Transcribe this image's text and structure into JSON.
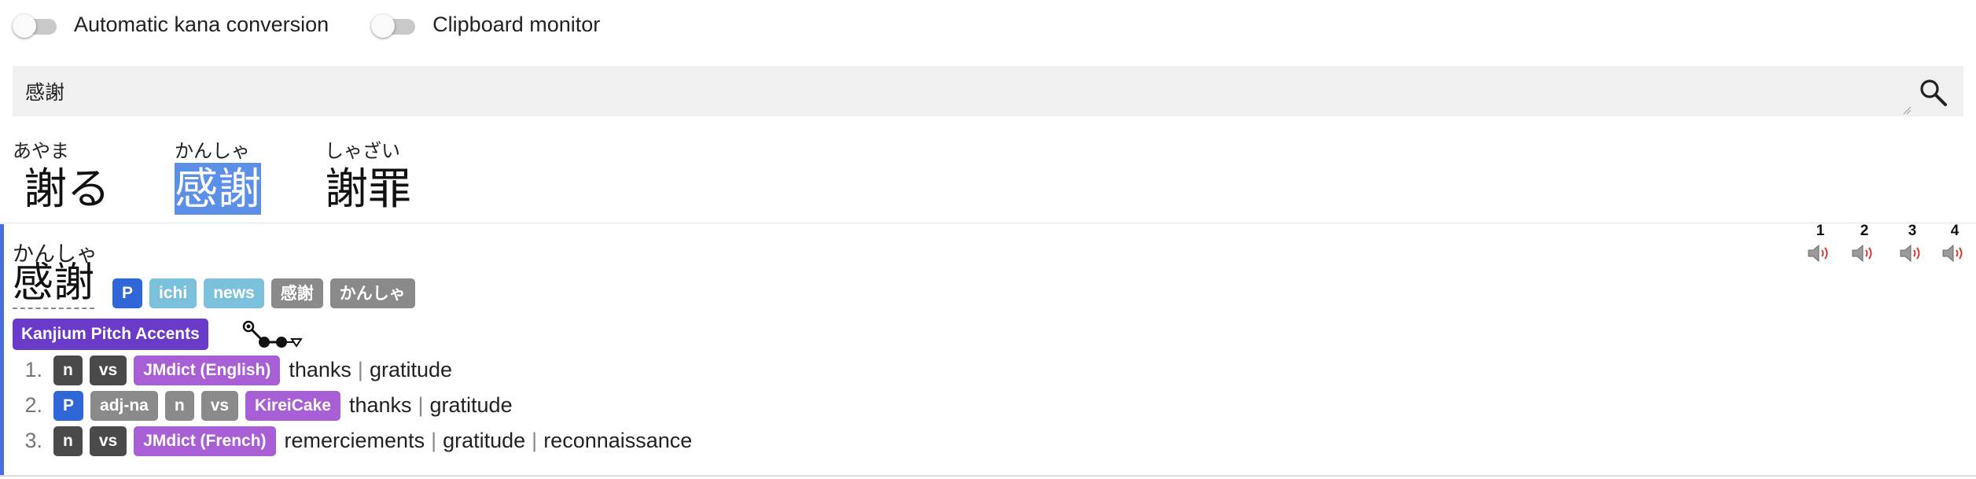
{
  "toggles": [
    {
      "label": "Automatic kana conversion",
      "checked": false
    },
    {
      "label": "Clipboard monitor",
      "checked": false
    }
  ],
  "search": {
    "value": "感謝",
    "icon": "search-icon"
  },
  "suggestions": [
    {
      "reading": "あやま",
      "word": "謝る",
      "active": false
    },
    {
      "reading": "かんしゃ",
      "word": "感謝",
      "active": true
    },
    {
      "reading": "しゃざい",
      "word": "謝罪",
      "active": false
    }
  ],
  "entry": {
    "reading": "かんしゃ",
    "headword": "感謝",
    "tags": [
      "P",
      "ichi",
      "news",
      "感謝",
      "かんしゃ"
    ],
    "pitch_label": "Kanjium Pitch Accents",
    "senses": [
      {
        "number": "1.",
        "tags": [
          "n",
          "vs"
        ],
        "source": "JMdict (English)",
        "glosses": [
          "thanks",
          "gratitude"
        ]
      },
      {
        "number": "2.",
        "tags": [
          "P",
          "adj-na",
          "n",
          "vs"
        ],
        "source": "KireiCake",
        "glosses": [
          "thanks",
          "gratitude"
        ]
      },
      {
        "number": "3.",
        "tags": [
          "n",
          "vs"
        ],
        "source": "JMdict (French)",
        "glosses": [
          "remerciements",
          "gratitude",
          "reconnaissance"
        ]
      }
    ],
    "audio": [
      {
        "number": "1"
      },
      {
        "number": "2"
      },
      {
        "number": "3"
      },
      {
        "number": "4"
      }
    ]
  },
  "colors": {
    "accent": "#4a6ee0",
    "selected": "#5b8fe8",
    "tag_purple": "#a85fd6",
    "tag_violet": "#6a3ac8",
    "tag_light_blue": "#7cc1dc",
    "tag_blue": "#2f67d8"
  }
}
